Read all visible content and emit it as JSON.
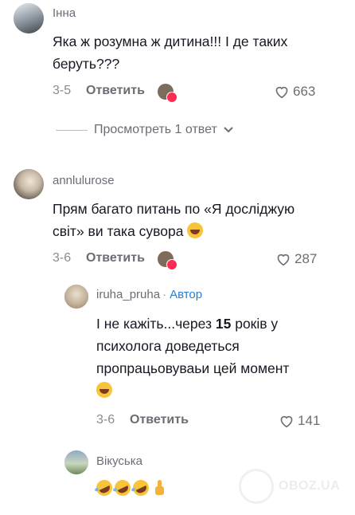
{
  "comments": [
    {
      "author": "Інна",
      "text_lines": [
        "Яка ж розумна ж дитина!!! І де таких",
        "беруть???"
      ],
      "date": "3-5",
      "reply_label": "Ответить",
      "likes": "663",
      "view_replies": "Просмотреть 1 ответ"
    },
    {
      "author": "annlulurose",
      "text_lines": [
        "Прям багато питань по «Я досліджую",
        "світ» ви така сувора"
      ],
      "date": "3-6",
      "reply_label": "Ответить",
      "likes": "287"
    }
  ],
  "replies": [
    {
      "author": "iruha_pruha",
      "author_badge_sep": "·",
      "author_badge": "Автор",
      "text_line1_pre": "І не кажіть...через ",
      "text_line1_num": "15",
      "text_line1_post": " років у",
      "text_line2": "психолога доведеться",
      "text_line3": "пропрацьовуваьи цей момент",
      "date": "3-6",
      "reply_label": "Ответить",
      "likes": "141"
    },
    {
      "author": "Вікуська"
    }
  ],
  "watermark": "OBOZ.UA",
  "colors": {
    "like_heart": "#6b6d75",
    "badge_heart": "#fe2c55",
    "author_badge": "#2a7fd1"
  }
}
